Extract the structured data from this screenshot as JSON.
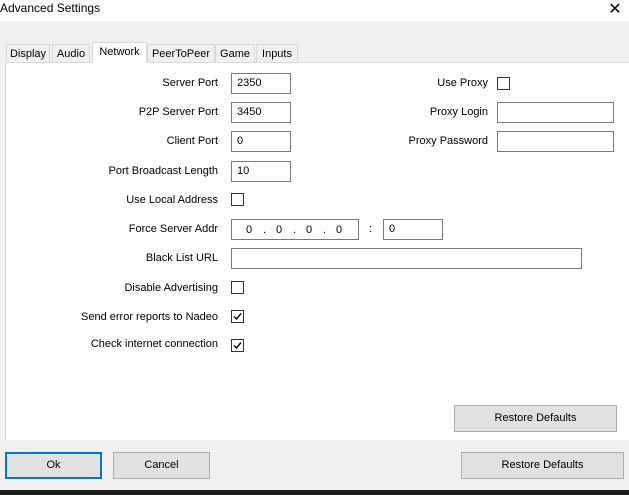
{
  "window": {
    "title": "Advanced Settings"
  },
  "tabs": [
    {
      "label": "Display",
      "active": false
    },
    {
      "label": "Audio",
      "active": false
    },
    {
      "label": "Network",
      "active": true
    },
    {
      "label": "PeerToPeer",
      "active": false
    },
    {
      "label": "Game",
      "active": false
    },
    {
      "label": "Inputs",
      "active": false
    }
  ],
  "network": {
    "server_port": {
      "label": "Server Port",
      "value": "2350"
    },
    "p2p_server_port": {
      "label": "P2P Server Port",
      "value": "3450"
    },
    "client_port": {
      "label": "Client Port",
      "value": "0"
    },
    "port_broadcast_length": {
      "label": "Port Broadcast Length",
      "value": "10"
    },
    "use_local_address": {
      "label": "Use Local Address",
      "checked": false
    },
    "force_server_addr": {
      "label": "Force Server Addr",
      "octets": [
        "0",
        "0",
        "0",
        "0"
      ],
      "dot": ".",
      "colon": ":",
      "port": "0"
    },
    "black_list_url": {
      "label": "Black List URL",
      "value": ""
    },
    "disable_advertising": {
      "label": "Disable Advertising",
      "checked": false
    },
    "send_error_reports": {
      "label": "Send error reports to Nadeo",
      "checked": true
    },
    "check_internet": {
      "label": "Check internet connection",
      "checked": true
    },
    "use_proxy": {
      "label": "Use Proxy",
      "checked": false
    },
    "proxy_login": {
      "label": "Proxy Login",
      "value": ""
    },
    "proxy_password": {
      "label": "Proxy Password",
      "value": ""
    },
    "restore_defaults_tab_label": "Restore Defaults"
  },
  "footer": {
    "ok_label": "Ok",
    "cancel_label": "Cancel",
    "restore_defaults_label": "Restore Defaults"
  },
  "icons": {
    "close": "close-icon",
    "check": "checkmark-icon"
  },
  "colors": {
    "accent": "#0078d7",
    "panel": "#ffffff",
    "window": "#f0f0f0"
  }
}
